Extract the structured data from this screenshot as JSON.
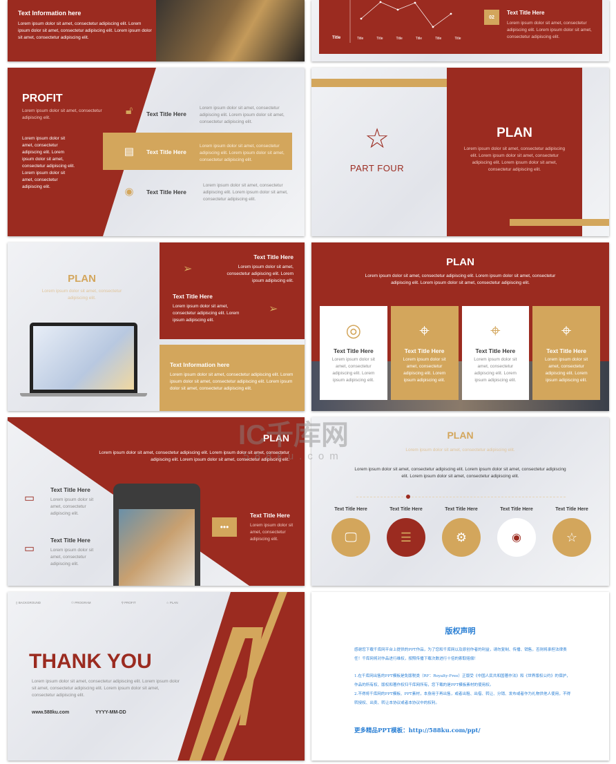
{
  "colors": {
    "red": "#9b2b20",
    "gold": "#d3a65c",
    "grey": "#e6e7ec"
  },
  "lorem": {
    "short": "Lorem ipsum dolor sit amet, consectetur adipiscing elit.",
    "med": "Lorem ipsum dolor sit amet, consectetur adipiscing elit. Lorem ipsum dolor sit amet, consectetur adipiscing elit.",
    "long": "Lorem ipsum dolor sit amet, consectetur adipiscing elit. Lorem ipsum dolor sit amet, consectetur adipiscing elit. Lorem ipsum dolor sit amet, consectetur adipiscing elit.",
    "col": "Lorem ipsum dolor sit amet, consectetur adipiscing elit."
  },
  "slide1": {
    "title": "Text Information here",
    "body": "Lorem ipsum dolor sit amet, consectetur adipiscing elit. Lorem ipsum dolor sit amet, consectetur adipiscing elit. Lorem ipsum dolor sit amet, consectetur adipiscing elit."
  },
  "slide2": {
    "axis_title": "Title",
    "ticks": [
      "Title",
      "Title",
      "Title",
      "Title",
      "Title",
      "Title"
    ],
    "badge": "02",
    "title": "Text Title Here",
    "body": "Lorem ipsum dolor sit amet, consectetur adipiscing elit. Lorem ipsum dolor sit amet, consectetur adipiscing elit."
  },
  "slide3": {
    "title": "PROFIT",
    "sub": "Lorem ipsum dolor sit amet, consectetur adipiscing elit.",
    "body": "Lorem ipsum dolor sit amet, consectetur adipiscing elit. Lorem ipsum dolor sit amet, consectetur adipiscing elit. Lorem ipsum dolor sit amet, consectetur adipiscing elit.",
    "items": [
      {
        "icon": "unlock-icon",
        "title": "Text Title Here",
        "body": "Lorem ipsum dolor sit amet, consectetur adipiscing elit. Lorem ipsum dolor sit amet, consectetur adipiscing elit."
      },
      {
        "icon": "document-icon",
        "title": "Text Title Here",
        "body": "Lorem ipsum dolor sit amet, consectetur adipiscing elit. Lorem ipsum dolor sit amet, consectetur adipiscing elit."
      },
      {
        "icon": "location-pin-icon",
        "title": "Text Title Here",
        "body": "Lorem ipsum dolor sit amet, consectetur adipiscing elit. Lorem ipsum dolor sit amet, consectetur adipiscing elit."
      }
    ]
  },
  "slide4": {
    "part": "PART FOUR",
    "title": "PLAN",
    "body": "Lorem ipsum dolor sit amet, consectetur adipiscing elit. Lorem ipsum dolor sit amet, consectetur adipiscing elit. Lorem ipsum dolor sit amet, consectetur adipiscing elit."
  },
  "slide5": {
    "title": "PLAN",
    "sub": "Lorem ipsum dolor sit amet, consectetur adipiscing elit.",
    "t1": "Text Title Here",
    "b1": "Lorem ipsum dolor sit amet, consectetur adipiscing elit. Lorem ipsum adipiscing elit.",
    "t2": "Text Title Here",
    "b2": "Lorem ipsum dolor sit amet, consectetur adipiscing elit. Lorem ipsum adipiscing elit.",
    "t3": "Text Information here",
    "b3": "Lorem ipsum dolor sit amet, consectetur adipiscing elit. Lorem ipsum dolor sit amet, consectetur adipiscing elit. Lorem ipsum dolor sit amet, consectetur adipiscing elit."
  },
  "slide6": {
    "title": "PLAN",
    "body": "Lorem ipsum dolor sit amet, consectetur adipiscing elit. Lorem ipsum dolor sit amet, consectetur adipiscing elit. Lorem ipsum dolor sit amet, consectetur adipiscing elit.",
    "cards": [
      {
        "title": "Text Title Here",
        "body": "Lorem ipsum dolor sit amet, consectetur adipiscing elit. Lorem ipsum adipiscing elit."
      },
      {
        "title": "Text Title Here",
        "body": "Lorem ipsum dolor sit amet, consectetur adipiscing elit. Lorem ipsum adipiscing elit."
      },
      {
        "title": "Text Title Here",
        "body": "Lorem ipsum dolor sit amet, consectetur adipiscing elit. Lorem ipsum adipiscing elit."
      },
      {
        "title": "Text Title Here",
        "body": "Lorem ipsum dolor sit amet, consectetur adipiscing elit. Lorem ipsum adipiscing elit."
      }
    ]
  },
  "slide7": {
    "title": "PLAN",
    "body": "Lorem ipsum dolor sit amet, consectetur adipiscing elit. Lorem ipsum dolor sit amet, consectetur adipiscing elit. Lorem ipsum dolor sit amet, consectetur adipiscing elit.",
    "items": [
      {
        "title": "Text Title Here",
        "body": "Lorem ipsum dolor sit amet, consectetur adipiscing elit."
      },
      {
        "title": "Text Title Here",
        "body": "Lorem ipsum dolor sit amet, consectetur adipiscing elit."
      },
      {
        "title": "Text Title Here",
        "body": "Lorem ipsum dolor sit amet, consectetur adipiscing elit."
      }
    ]
  },
  "slide8": {
    "title": "PLAN",
    "sub": "Lorem ipsum dolor sit amet, consectetur adipiscing elit.",
    "body": "Lorem ipsum dolor sit amet, consectetur adipiscing elit. Lorem ipsum dolor sit amet, consectetur adipiscing elit. Lorem ipsum dolor sit amet, consectetur adipiscing elit.",
    "steps": [
      {
        "title": "Text Title Here",
        "icon": "monitor-icon"
      },
      {
        "title": "Text Title Here",
        "icon": "server-icon"
      },
      {
        "title": "Text Title Here",
        "icon": "gear-icon"
      },
      {
        "title": "Text Title Here",
        "icon": "location-pin-icon"
      },
      {
        "title": "Text Title Here",
        "icon": "star-icon"
      }
    ]
  },
  "slide9": {
    "nav": [
      "BACKGROUND",
      "PROGRAM",
      "PROFIT",
      "PLAN"
    ],
    "title": "THANK YOU",
    "body": "Lorem ipsum dolor sit amet, consectetur adipiscing elit. Lorem ipsum dolor sit amet, consectetur adipiscing elit. Lorem ipsum dolor sit amet, consectetur adipiscing elit.",
    "site": "www.588ku.com",
    "date": "YYYY-MM-DD"
  },
  "slide10": {
    "title": "版权声明",
    "p1": "感谢您下载千库网平台上提供的PPT作品，为了您和千库网以及原创作者的利益，请勿复制、传播、销售，否则将承担法律责任！千库网将对作品进行维权，按照传播下载次数进行十倍的索取赔偿！",
    "p2": "1.在千库网出售的PPT模板是免版税类（RF：Royalty-Free）正版受《中国人民共和国著作法》和《世界版权公约》的保护，作品的所有权、版权和著作权归千库网所有，您下载的是PPT模板素材的使用权。",
    "p3": "2.不得将千库网的PPT模板、PPT素材，本身用于再出售，或者出租、出借、转让、分销、发布或者作为礼物供他人使用，不得转授权、出卖、转让本协议或者本协议中的权利。",
    "more": "更多精品PPT模板：http://588ku.com/ppt/"
  },
  "watermark": {
    "brand": "千库网",
    "url": "588ku.com"
  }
}
